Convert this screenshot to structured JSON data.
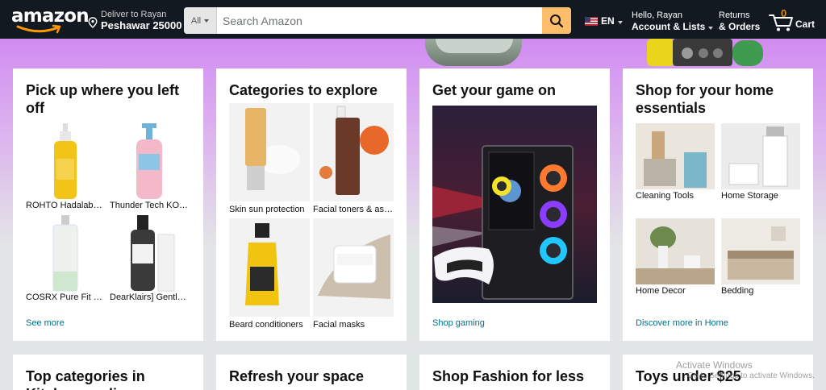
{
  "header": {
    "logo": "amazon",
    "deliver_line1": "Deliver to Rayan",
    "deliver_line2": "Peshawar 25000",
    "search_category": "All",
    "search_placeholder": "Search Amazon",
    "language": "EN",
    "account_line1": "Hello, Rayan",
    "account_line2": "Account & Lists",
    "returns_line1": "Returns",
    "returns_line2": "& Orders",
    "cart_count": "0",
    "cart_label": "Cart"
  },
  "cards": {
    "recent": {
      "title": "Pick up where you left off",
      "items": [
        {
          "caption": "ROHTO Hadalabo Gokujyun Premium Cleansing Oil"
        },
        {
          "caption": "Thunder Tech KOSÉ Softymo"
        },
        {
          "caption": "COSRX Pure Fit Cica Toner"
        },
        {
          "caption": "DearKlairs] Gentle Black Deep Cleansing Oil"
        }
      ],
      "link": "See more"
    },
    "categories": {
      "title": "Categories to explore",
      "items": [
        {
          "caption": "Skin sun protection"
        },
        {
          "caption": "Facial toners & astringents"
        },
        {
          "caption": "Beard conditioners"
        },
        {
          "caption": "Facial masks"
        }
      ]
    },
    "gaming": {
      "title": "Get your game on",
      "link": "Shop gaming"
    },
    "home": {
      "title": "Shop for your home essentials",
      "items": [
        {
          "caption": "Cleaning Tools"
        },
        {
          "caption": "Home Storage"
        },
        {
          "caption": "Home Decor"
        },
        {
          "caption": "Bedding"
        }
      ],
      "link": "Discover more in Home"
    },
    "row2": [
      {
        "title": "Top categories in Kitchen appliances"
      },
      {
        "title": "Refresh your space"
      },
      {
        "title": "Shop Fashion for less"
      },
      {
        "title": "Toys under $25"
      }
    ]
  },
  "watermark": {
    "line1": "Activate Windows",
    "line2": "Go to Settings to activate Windows."
  },
  "colors": {
    "nav_bg": "#131921",
    "search_button": "#febd69",
    "link": "#007185",
    "cart_count": "#f08804"
  }
}
